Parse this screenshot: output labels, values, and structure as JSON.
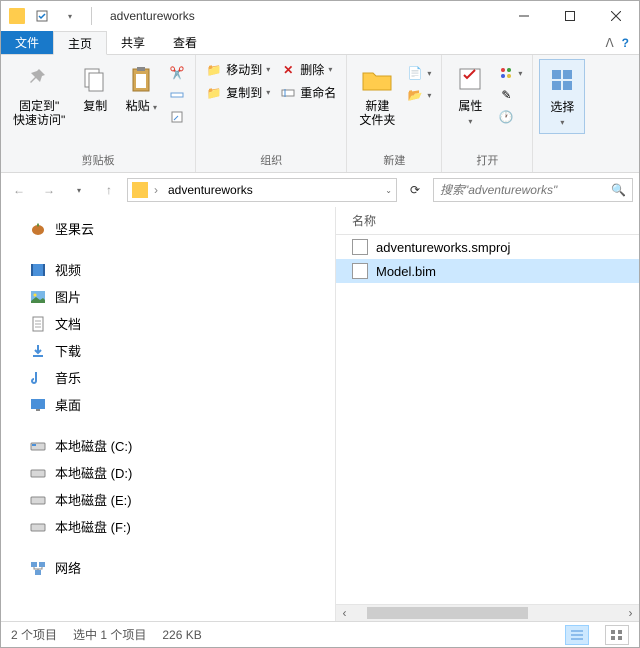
{
  "title": "adventureworks",
  "tabs": {
    "file": "文件",
    "home": "主页",
    "share": "共享",
    "view": "查看"
  },
  "ribbon": {
    "clipboard": {
      "label": "剪贴板",
      "pin": "固定到\"\n快速访问\"",
      "copy": "复制",
      "paste": "粘贴"
    },
    "organize": {
      "label": "组织",
      "moveTo": "移动到",
      "copyTo": "复制到",
      "delete": "删除",
      "rename": "重命名"
    },
    "new": {
      "label": "新建",
      "newFolder": "新建\n文件夹"
    },
    "open": {
      "label": "打开",
      "properties": "属性"
    },
    "select": {
      "label": "",
      "select": "选择"
    }
  },
  "address": {
    "crumb": "adventureworks"
  },
  "search": {
    "placeholder": "搜索\"adventureworks\""
  },
  "sidebar": [
    {
      "icon": "nut",
      "label": "坚果云"
    },
    {
      "icon": "video",
      "label": "视频"
    },
    {
      "icon": "image",
      "label": "图片"
    },
    {
      "icon": "doc",
      "label": "文档"
    },
    {
      "icon": "download",
      "label": "下载"
    },
    {
      "icon": "music",
      "label": "音乐"
    },
    {
      "icon": "desktop",
      "label": "桌面"
    },
    {
      "icon": "disk-c",
      "label": "本地磁盘 (C:)"
    },
    {
      "icon": "disk",
      "label": "本地磁盘 (D:)"
    },
    {
      "icon": "disk",
      "label": "本地磁盘 (E:)"
    },
    {
      "icon": "disk",
      "label": "本地磁盘 (F:)"
    }
  ],
  "networkLabel": "网络",
  "columns": {
    "name": "名称"
  },
  "files": [
    {
      "name": "adventureworks.smproj",
      "selected": false
    },
    {
      "name": "Model.bim",
      "selected": true
    }
  ],
  "status": {
    "items": "2 个项目",
    "selected": "选中 1 个项目",
    "size": "226 KB"
  }
}
